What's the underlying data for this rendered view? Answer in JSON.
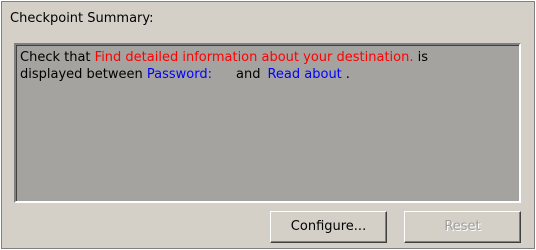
{
  "group": {
    "title": "Checkpoint Summary:"
  },
  "summary": {
    "line1_prefix": "Check that ",
    "checked_text": "Find detailed information about your destination.",
    "line1_suffix": " is",
    "line2_prefix": "displayed between ",
    "between_start": "Password:",
    "and_word": "and",
    "between_end": "Read about",
    "period": ".",
    "colors": {
      "checked_text": "#ff0000",
      "between": "#0000ff"
    }
  },
  "buttons": {
    "configure_label": "Configure...",
    "reset_label": "Reset",
    "reset_enabled": false
  }
}
